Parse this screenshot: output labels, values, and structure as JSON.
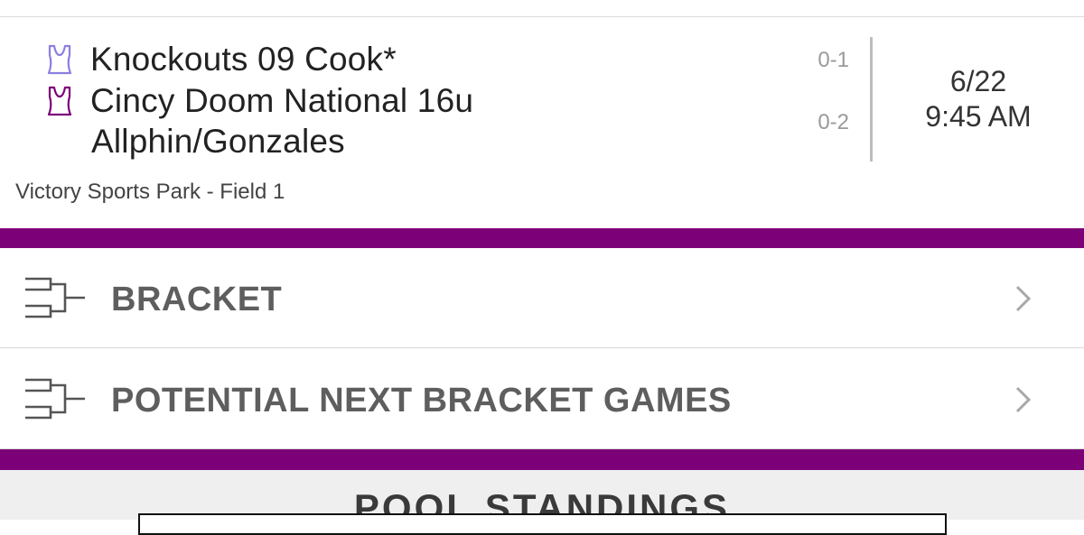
{
  "game": {
    "team1": {
      "name": "Knockouts 09 Cook*",
      "record": "0-1",
      "jersey_icon": "jersey-outline-icon",
      "color": "#8a7fe0"
    },
    "team2": {
      "name_line1": "Cincy Doom National 16u",
      "name_line2": "Allphin/Gonzales",
      "record": "0-2",
      "jersey_icon": "jersey-outline-icon",
      "color": "#7c0078"
    },
    "date": "6/22",
    "time": "9:45 AM",
    "location": "Victory Sports Park - Field 1"
  },
  "menu": {
    "items": [
      {
        "label": "BRACKET",
        "icon": "bracket-icon",
        "chevron": "chevron-right-icon"
      },
      {
        "label": "POTENTIAL NEXT BRACKET GAMES",
        "icon": "bracket-icon",
        "chevron": "chevron-right-icon"
      }
    ]
  },
  "pool": {
    "title": "POOL STANDINGS"
  },
  "colors": {
    "accent": "#7c0078",
    "text": "#222222",
    "muted": "#9a9a9a"
  }
}
